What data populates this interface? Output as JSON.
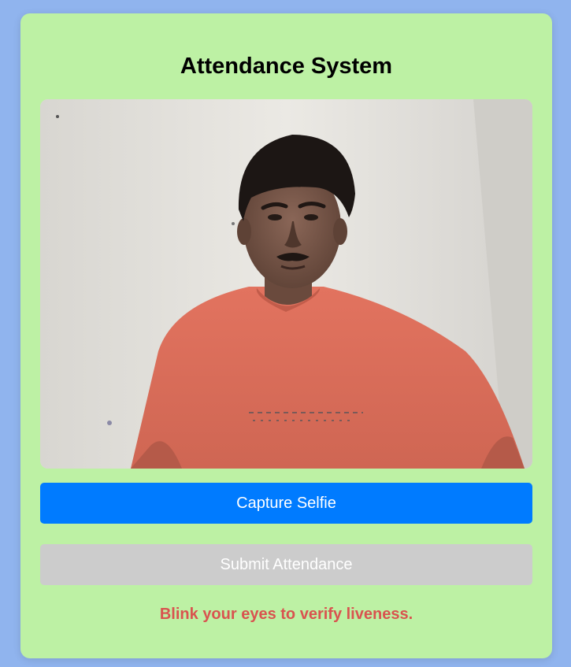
{
  "page": {
    "title": "Attendance System"
  },
  "camera": {
    "feed": "live-webcam-feed"
  },
  "buttons": {
    "capture_label": "Capture Selfie",
    "submit_label": "Submit Attendance",
    "submit_disabled": true
  },
  "status": {
    "message": "Blink your eyes to verify liveness."
  },
  "colors": {
    "background": "#90b4ee",
    "card": "#bdf1a4",
    "primary": "#007bff",
    "disabled": "#cccccc",
    "status_text": "#d9534f"
  }
}
